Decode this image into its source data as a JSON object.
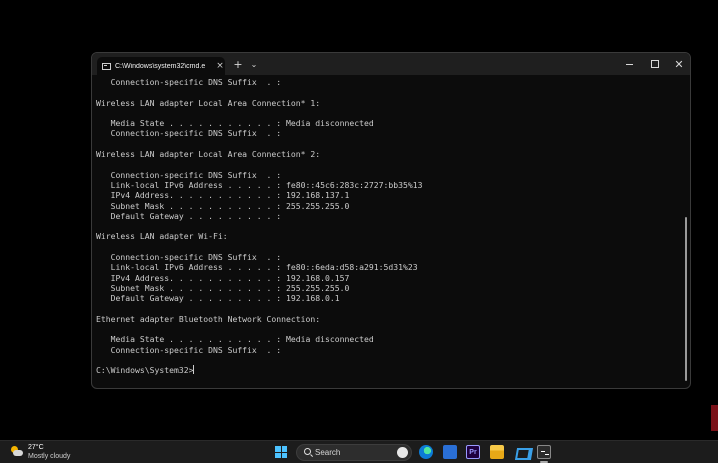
{
  "window": {
    "tab_title": "C:\\Windows\\system32\\cmd.e",
    "tab_close_glyph": "×",
    "new_tab_glyph": "+",
    "dropdown_glyph": "⌄",
    "close_glyph": "✕"
  },
  "terminal": {
    "lines": [
      "   Connection-specific DNS Suffix  . :",
      "",
      "Wireless LAN adapter Local Area Connection* 1:",
      "",
      "   Media State . . . . . . . . . . . : Media disconnected",
      "   Connection-specific DNS Suffix  . :",
      "",
      "Wireless LAN adapter Local Area Connection* 2:",
      "",
      "   Connection-specific DNS Suffix  . :",
      "   Link-local IPv6 Address . . . . . : fe80::45c6:283c:2727:bb35%13",
      "   IPv4 Address. . . . . . . . . . . : 192.168.137.1",
      "   Subnet Mask . . . . . . . . . . . : 255.255.255.0",
      "   Default Gateway . . . . . . . . . :",
      "",
      "Wireless LAN adapter Wi-Fi:",
      "",
      "   Connection-specific DNS Suffix  . :",
      "   Link-local IPv6 Address . . . . . : fe80::6eda:d58:a291:5d31%23",
      "   IPv4 Address. . . . . . . . . . . : 192.168.0.157",
      "   Subnet Mask . . . . . . . . . . . : 255.255.255.0",
      "   Default Gateway . . . . . . . . . : 192.168.0.1",
      "",
      "Ethernet adapter Bluetooth Network Connection:",
      "",
      "   Media State . . . . . . . . . . . : Media disconnected",
      "   Connection-specific DNS Suffix  . :",
      "",
      "C:\\Windows\\System32>"
    ]
  },
  "taskbar": {
    "weather_temp": "27°C",
    "weather_desc": "Mostly cloudy",
    "search_label": "Search",
    "premiere_label": "Pr"
  },
  "icons": [
    "cmd-icon",
    "weather-icon",
    "windows-start-icon",
    "search-icon",
    "edge-icon",
    "store-icon",
    "premiere-icon",
    "file-explorer-icon",
    "vscode-icon",
    "terminal-icon"
  ]
}
